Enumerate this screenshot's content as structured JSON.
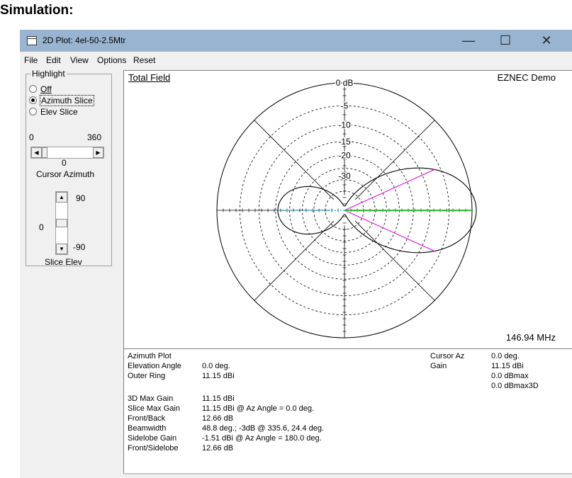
{
  "heading": "Simulation:",
  "window": {
    "title": "2D Plot: 4el-50-2.5Mtr",
    "buttons": {
      "minimize": "—",
      "maximize": "☐",
      "close": "✕"
    }
  },
  "menu": [
    "File",
    "Edit",
    "View",
    "Options",
    "Reset"
  ],
  "highlight": {
    "legend": "Highlight",
    "options": [
      {
        "label": "Off",
        "selected": false
      },
      {
        "label": "Azimuth Slice",
        "selected": true
      },
      {
        "label": "Elev Slice",
        "selected": false
      }
    ]
  },
  "azimuth_slider": {
    "min_label": "0",
    "max_label": "360",
    "value": "0",
    "caption": "Cursor Azimuth",
    "level": 0
  },
  "elev_slider": {
    "top_label": "90",
    "bottom_label": "-90",
    "value": "0",
    "caption": "Slice Elev"
  },
  "plot": {
    "title": "Total Field",
    "brand": "EZNEC Demo",
    "frequency": "146.94 MHz",
    "ring_labels": [
      "0 dB",
      "-5",
      "-10",
      "-15",
      "-20",
      "-30"
    ],
    "colors": {
      "pattern": "#000000",
      "highlight": "#e020e0",
      "cursor": "#33bb33",
      "back": "#33bbee"
    }
  },
  "info": {
    "left": [
      {
        "label": "Azimuth Plot",
        "value": ""
      },
      {
        "label": "Elevation Angle",
        "value": "0.0 deg."
      },
      {
        "label": "Outer Ring",
        "value": "11.15 dBi"
      },
      {
        "label": "3D Max Gain",
        "value": "11.15 dBi"
      },
      {
        "label": "Slice Max Gain",
        "value": "11.15 dBi @ Az Angle = 0.0 deg."
      },
      {
        "label": "Front/Back",
        "value": "12.66 dB"
      },
      {
        "label": "Beamwidth",
        "value": "48.8 deg.; -3dB @ 335.6, 24.4 deg."
      },
      {
        "label": "Sidelobe Gain",
        "value": "-1.51 dBi @ Az Angle = 180.0 deg."
      },
      {
        "label": "Front/Sidelobe",
        "value": "12.66 dB"
      }
    ],
    "cursor_az_label": "Cursor Az",
    "cursor_az_value": "0.0 deg.",
    "gain_label": "Gain",
    "gain_values": [
      "11.15 dBi",
      "0.0 dBmax",
      "0.0 dBmax3D"
    ]
  }
}
